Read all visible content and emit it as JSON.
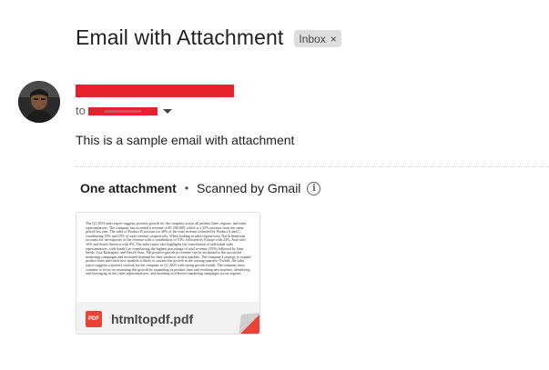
{
  "email": {
    "subject": "Email with Attachment",
    "label": "Inbox",
    "label_remove": "×",
    "to_label": "to",
    "body": "This is a sample email with attachment"
  },
  "attachments": {
    "title": "One attachment",
    "separator": "•",
    "scan_status": "Scanned by Gmail",
    "info_symbol": "i",
    "file": {
      "name": "htmltopdf.pdf",
      "type_badge": "PDF",
      "preview_text": "The Q1 2023 sales report suggests positive growth for the company across all product lines, regions, and sales representatives. The company has recorded a revenue of $1,500,000, which is a 15% increase from the same period last year. The sales of Product B account for 40% of the total revenue followed by Product A and C, contributing 35% and 25% of total revenue, respectively. When looking at sales region-wise, North American accounts for the majority of the revenue with a contribution of 53%, followed by Europe with 24%, Asia with 16% and South America with 8%. The sales report also highlights the contribution of individual sales representatives, with Sarah Lee contributing the highest percentage of total revenue (35%) followed by John Smith, Lisa Rodriguez, and David Chen. The positive growth in revenue can be attributed to the successful marketing campaigns and increased demand for their products in new markets. The company's strategy to expand product lines and reach new markets is likely to sustain this growth in the coming quarters. Overall, the sales report suggests a positive outlook for the company in Q1 2023 with strong growth trends. The company must continue to focus on sustaining this growth by expanding its product lines and reaching new markets, identifying and leveraging its key sales representatives, and investing in effective marketing campaigns across regions."
    }
  },
  "colors": {
    "redaction": "#e8212e",
    "pdf_red": "#ea4335",
    "chip_bg": "#dddddd"
  },
  "icons": [
    "avatar",
    "caret-down-icon",
    "info-icon",
    "pdf-file-icon",
    "remove-label-icon"
  ]
}
